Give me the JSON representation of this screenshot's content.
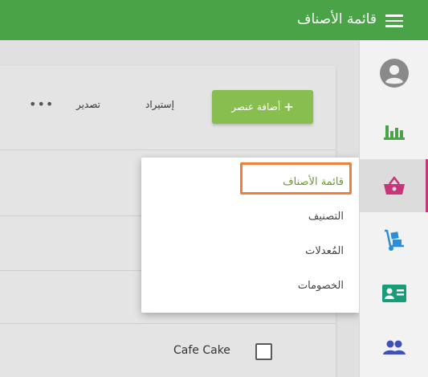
{
  "header": {
    "title": "قائمة الأصناف",
    "background": "#4aa347"
  },
  "toolbar": {
    "add_label": "أضافة عنصر",
    "add_plus": "+",
    "import_label": "إستيراد",
    "export_label": "تصدير",
    "more_label": "•••"
  },
  "dropdown": {
    "items": [
      {
        "label": "قائمة الأصناف",
        "selected": true
      },
      {
        "label": "التصنيف",
        "selected": false
      },
      {
        "label": "المُعدلات",
        "selected": false
      },
      {
        "label": "الخصومات",
        "selected": false
      }
    ],
    "highlight_color": "#f07f3c"
  },
  "table": {
    "rows": [
      {
        "name": "Cafe Cake",
        "checked": false
      }
    ]
  },
  "sidebar": {
    "items": [
      {
        "icon": "account-circle-icon",
        "color": "#8a8a8a",
        "active": false
      },
      {
        "icon": "bar-chart-icon",
        "color": "#4aa347",
        "active": false
      },
      {
        "icon": "shopping-basket-icon",
        "color": "#c9347a",
        "active": true
      },
      {
        "icon": "hand-truck-icon",
        "color": "#2a8fd6",
        "active": false
      },
      {
        "icon": "contact-card-icon",
        "color": "#1a9c7a",
        "active": false
      },
      {
        "icon": "people-icon",
        "color": "#3f51b5",
        "active": false
      }
    ],
    "active_accent": "#c9347a"
  }
}
